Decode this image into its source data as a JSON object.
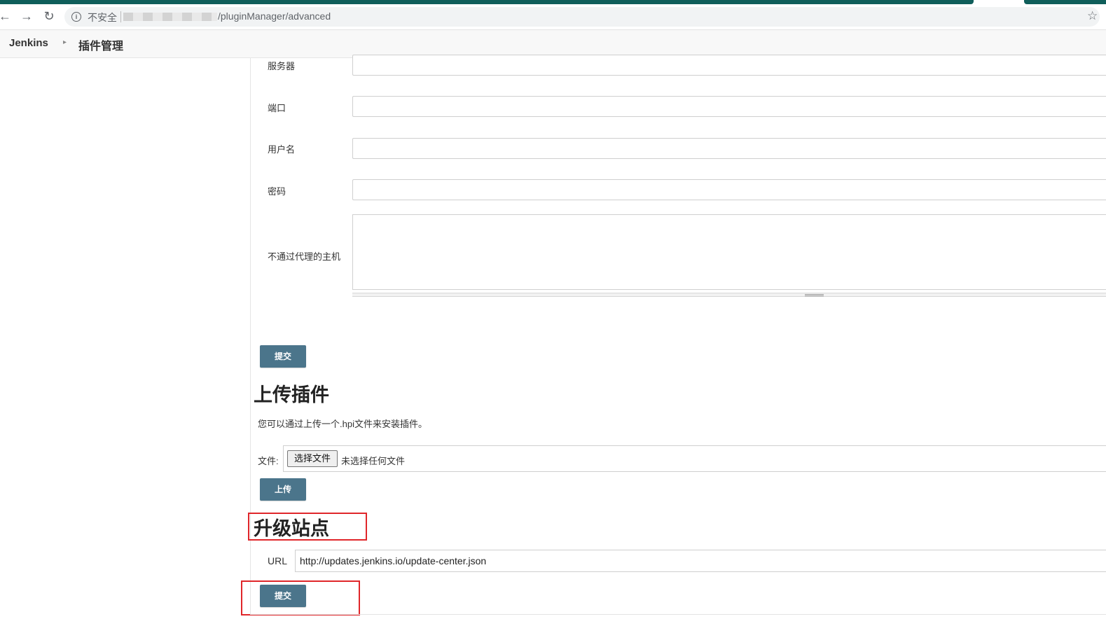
{
  "browser": {
    "security_label": "不安全",
    "url_path": "/pluginManager/advanced"
  },
  "breadcrumb": {
    "home": "Jenkins",
    "page": "插件管理"
  },
  "proxy_form": {
    "server_label": "服务器",
    "port_label": "端口",
    "username_label": "用户名",
    "password_label": "密码",
    "no_proxy_hosts_label": "不通过代理的主机",
    "submit_label": "提交"
  },
  "upload_plugin": {
    "title": "上传插件",
    "description": "您可以通过上传一个.hpi文件来安装插件。",
    "file_label": "文件:",
    "choose_file_label": "选择文件",
    "no_file_label": "未选择任何文件",
    "upload_label": "上传"
  },
  "update_site": {
    "title": "升级站点",
    "url_label": "URL",
    "url_value": "http://updates.jenkins.io/update-center.json",
    "submit_label": "提交"
  },
  "colors": {
    "button": "#4b758b",
    "highlight": "#e0262a",
    "tabstrip": "#0f5e5a"
  }
}
